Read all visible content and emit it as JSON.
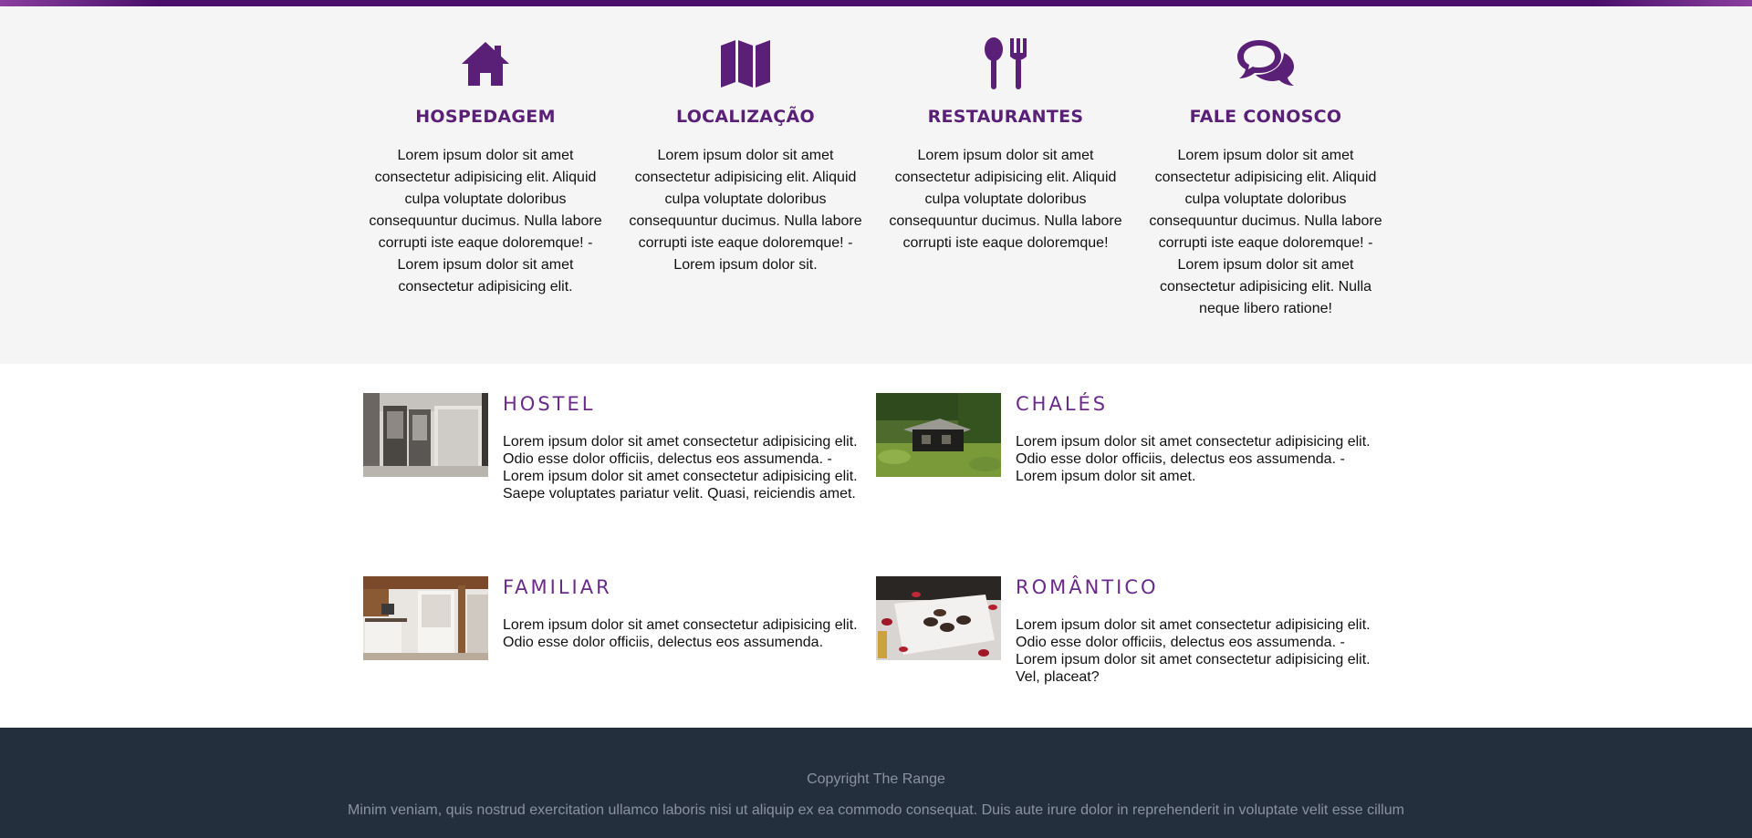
{
  "services": [
    {
      "icon": "home-icon",
      "title": "HOSPEDAGEM",
      "text": "Lorem ipsum dolor sit amet consectetur adipisicing elit. Aliquid culpa voluptate doloribus consequuntur ducimus. Nulla labore corrupti iste eaque doloremque! - Lorem ipsum dolor sit amet consectetur adipisicing elit."
    },
    {
      "icon": "map-icon",
      "title": "LOCALIZAÇÃO",
      "text": "Lorem ipsum dolor sit amet consectetur adipisicing elit. Aliquid culpa voluptate doloribus consequuntur ducimus. Nulla labore corrupti iste eaque doloremque! - Lorem ipsum dolor sit."
    },
    {
      "icon": "utensils-icon",
      "title": "RESTAURANTES",
      "text": "Lorem ipsum dolor sit amet consectetur adipisicing elit. Aliquid culpa voluptate doloribus consequuntur ducimus. Nulla labore corrupti iste eaque doloremque!"
    },
    {
      "icon": "chat-bubbles-icon",
      "title": "FALE CONOSCO",
      "text": "Lorem ipsum dolor sit amet consectetur adipisicing elit. Aliquid culpa voluptate doloribus consequuntur ducimus. Nulla labore corrupti iste eaque doloremque! - Lorem ipsum dolor sit amet consectetur adipisicing elit. Nulla neque libero ratione!"
    }
  ],
  "rooms": [
    {
      "title": "HOSTEL",
      "text": "Lorem ipsum dolor sit amet consectetur adipisicing elit. Odio esse dolor officiis, delectus eos assumenda. - Lorem ipsum dolor sit amet consectetur adipisicing elit. Saepe voluptates pariatur velit. Quasi, reiciendis amet."
    },
    {
      "title": "CHALÉS",
      "text": "Lorem ipsum dolor sit amet consectetur adipisicing elit. Odio esse dolor officiis, delectus eos assumenda. - Lorem ipsum dolor sit amet."
    },
    {
      "title": "FAMILIAR",
      "text": "Lorem ipsum dolor sit amet consectetur adipisicing elit. Odio esse dolor officiis, delectus eos assumenda."
    },
    {
      "title": "ROMÂNTICO",
      "text": "Lorem ipsum dolor sit amet consectetur adipisicing elit. Odio esse dolor officiis, delectus eos assumenda. - Lorem ipsum dolor sit amet consectetur adipisicing elit. Vel, placeat?"
    }
  ],
  "footer": {
    "copyright": "Copyright The Range",
    "tagline": "Minim veniam, quis nostrud exercitation ullamco laboris nisi ut aliquip ex ea commodo consequat. Duis aute irure dolor in reprehenderit in voluptate velit esse cillum"
  },
  "colors": {
    "accent": "#5a1f76",
    "top_bar": "#4a0f6b",
    "footer_bg": "#242f3d",
    "services_bg": "#f5f5f5"
  }
}
